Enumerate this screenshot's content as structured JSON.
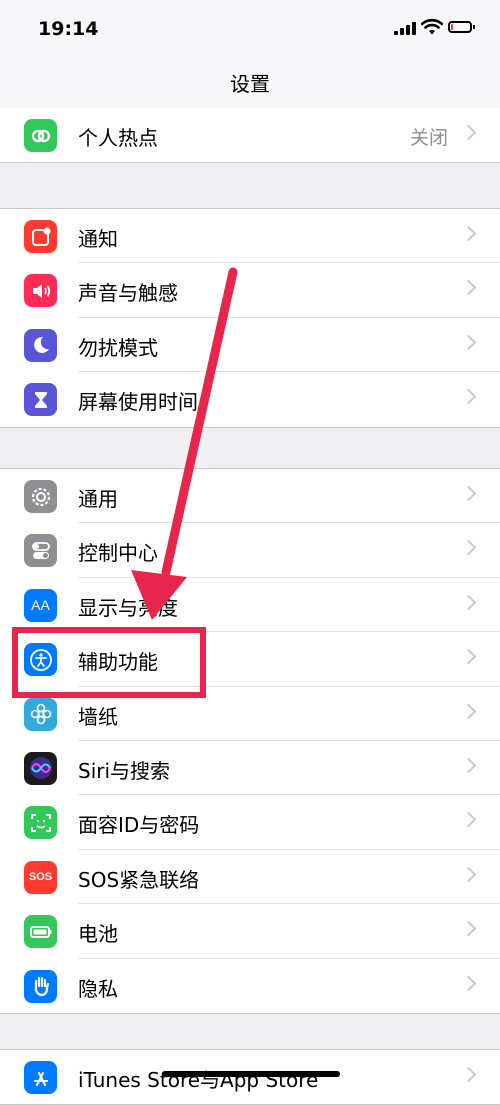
{
  "status": {
    "time": "19:14",
    "battery_level": 0.12
  },
  "nav": {
    "title": "设置"
  },
  "groups": [
    [
      {
        "label": "个人热点",
        "value": "关闭",
        "icon": "hotspot-icon",
        "color": "#34c759"
      }
    ],
    [
      {
        "label": "通知",
        "icon": "notifications-icon",
        "color": "#ff3b30"
      },
      {
        "label": "声音与触感",
        "icon": "speaker-icon",
        "color": "#ff2d55"
      },
      {
        "label": "勿扰模式",
        "icon": "moon-icon",
        "color": "#5856d6"
      },
      {
        "label": "屏幕使用时间",
        "icon": "hourglass-icon",
        "color": "#5856d6"
      }
    ],
    [
      {
        "label": "通用",
        "icon": "gear-icon",
        "color": "#8e8e93"
      },
      {
        "label": "控制中心",
        "icon": "toggles-icon",
        "color": "#8e8e93"
      },
      {
        "label": "显示与亮度",
        "icon": "text-size-icon",
        "color": "#007aff"
      },
      {
        "label": "辅助功能",
        "icon": "accessibility-icon",
        "color": "#007aff"
      },
      {
        "label": "墙纸",
        "icon": "flower-icon",
        "color": "#34aadc"
      },
      {
        "label": "Siri与搜索",
        "icon": "siri-icon",
        "color": "#1c1c1e"
      },
      {
        "label": "面容ID与密码",
        "icon": "face-id-icon",
        "color": "#34c759"
      },
      {
        "label": "SOS紧急联络",
        "icon": "sos-icon",
        "color": "#ff3b30",
        "glyph": "SOS"
      },
      {
        "label": "电池",
        "icon": "battery-icon",
        "color": "#34c759"
      },
      {
        "label": "隐私",
        "icon": "hand-icon",
        "color": "#007aff"
      }
    ],
    [
      {
        "label": "iTunes Store与App Store",
        "icon": "app-store-icon",
        "color": "#007aff"
      }
    ]
  ],
  "annotation": {
    "color": "#e8264c"
  }
}
